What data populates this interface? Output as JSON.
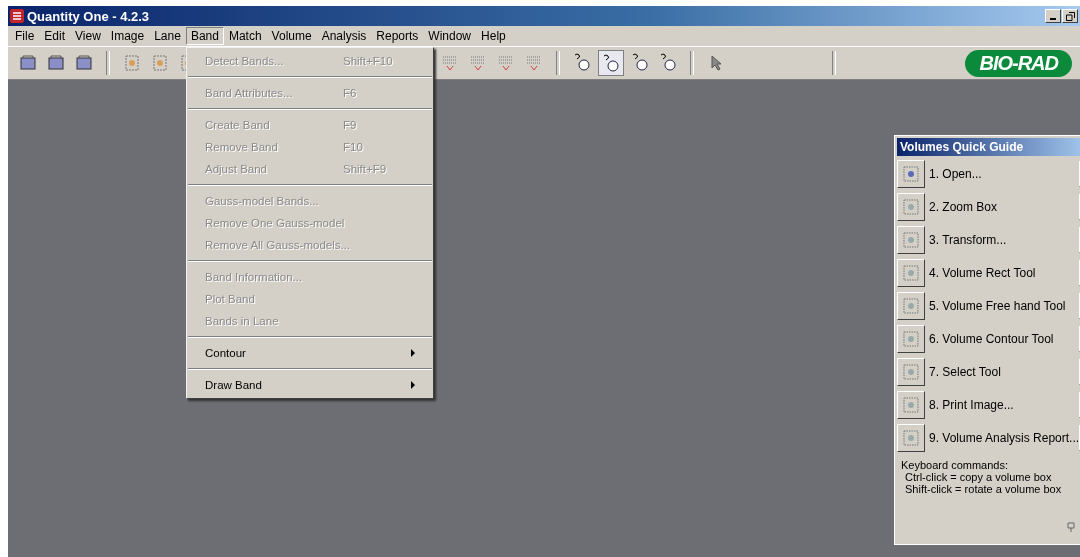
{
  "window": {
    "title": "Quantity One - 4.2.3"
  },
  "menu_bar": [
    {
      "label": "File",
      "selected": false
    },
    {
      "label": "Edit",
      "selected": false
    },
    {
      "label": "View",
      "selected": false
    },
    {
      "label": "Image",
      "selected": false
    },
    {
      "label": "Lane",
      "selected": false
    },
    {
      "label": "Band",
      "selected": true
    },
    {
      "label": "Match",
      "selected": false
    },
    {
      "label": "Volume",
      "selected": false
    },
    {
      "label": "Analysis",
      "selected": false
    },
    {
      "label": "Reports",
      "selected": false
    },
    {
      "label": "Window",
      "selected": false
    },
    {
      "label": "Help",
      "selected": false
    }
  ],
  "logo": "BIO-RAD",
  "band_menu": [
    {
      "kind": "item",
      "label": "Detect Bands...",
      "shortcut": "Shift+F10",
      "disabled": true
    },
    {
      "kind": "separator"
    },
    {
      "kind": "item",
      "label": "Band Attributes...",
      "shortcut": "F6",
      "disabled": true
    },
    {
      "kind": "separator"
    },
    {
      "kind": "item",
      "label": "Create Band",
      "shortcut": "F9",
      "disabled": true
    },
    {
      "kind": "item",
      "label": "Remove Band",
      "shortcut": "F10",
      "disabled": true
    },
    {
      "kind": "item",
      "label": "Adjust Band",
      "shortcut": "Shift+F9",
      "disabled": true
    },
    {
      "kind": "separator"
    },
    {
      "kind": "item",
      "label": "Gauss-model Bands...",
      "disabled": true
    },
    {
      "kind": "item",
      "label": "Remove One Gauss-model",
      "disabled": true
    },
    {
      "kind": "item",
      "label": "Remove All Gauss-models...",
      "disabled": true
    },
    {
      "kind": "separator"
    },
    {
      "kind": "item",
      "label": "Band Information...",
      "disabled": true
    },
    {
      "kind": "item",
      "label": "Plot Band",
      "disabled": true
    },
    {
      "kind": "item",
      "label": "Bands in Lane",
      "disabled": true
    },
    {
      "kind": "separator"
    },
    {
      "kind": "submenu",
      "label": "Contour",
      "disabled": false
    },
    {
      "kind": "separator"
    },
    {
      "kind": "submenu",
      "label": "Draw Band",
      "disabled": false
    }
  ],
  "quick_guide": {
    "title": "Volumes Quick Guide",
    "steps": [
      {
        "label": "1. Open..."
      },
      {
        "label": "2. Zoom Box"
      },
      {
        "label": "3. Transform..."
      },
      {
        "label": "4. Volume Rect Tool"
      },
      {
        "label": "5. Volume Free hand Tool"
      },
      {
        "label": "6. Volume Contour Tool"
      },
      {
        "label": "7. Select Tool"
      },
      {
        "label": "8. Print Image..."
      },
      {
        "label": "9. Volume Analysis Report..."
      }
    ],
    "notes": [
      "Keyboard commands:",
      "Ctrl-click = copy a volume box",
      "Shift-click = rotate a volume box"
    ]
  }
}
